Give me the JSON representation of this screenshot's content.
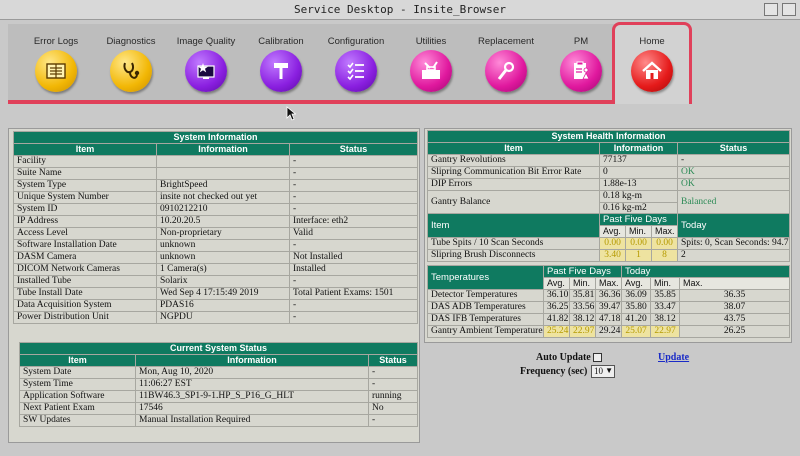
{
  "window": {
    "title": "Service Desktop - Insite_Browser"
  },
  "toolbar": [
    {
      "label": "Error Logs",
      "icon": "logbook-icon",
      "color": "#f2b705"
    },
    {
      "label": "Diagnostics",
      "icon": "stethoscope-icon",
      "color": "#f2b705"
    },
    {
      "label": "Image Quality",
      "icon": "monitor-star-icon",
      "color": "#8a1fe0"
    },
    {
      "label": "Calibration",
      "icon": "hammer-icon",
      "color": "#8a1fe0"
    },
    {
      "label": "Configuration",
      "icon": "checklist-icon",
      "color": "#8a1fe0"
    },
    {
      "label": "Utilities",
      "icon": "toolbox-icon",
      "color": "#e0189e"
    },
    {
      "label": "Replacement",
      "icon": "wrench-icon",
      "color": "#e0189e"
    },
    {
      "label": "PM",
      "icon": "clipboard-person-icon",
      "color": "#e0189e"
    },
    {
      "label": "Home",
      "icon": "home-icon",
      "color": "#e51a1a",
      "active": true
    }
  ],
  "system_info": {
    "title": "System Information",
    "headers": [
      "Item",
      "Information",
      "Status"
    ],
    "rows": [
      [
        "Facility",
        "",
        "-"
      ],
      [
        "Suite Name",
        "",
        "-"
      ],
      [
        "System Type",
        "BrightSpeed",
        "-"
      ],
      [
        "Unique System Number",
        "insite not checked out yet",
        "-"
      ],
      [
        "System ID",
        "0910212210",
        "-"
      ],
      [
        "IP Address",
        "10.20.20.5",
        "Interface: eth2"
      ],
      [
        "Access Level",
        "Non-proprietary",
        "Valid"
      ],
      [
        "Software Installation Date",
        "unknown",
        "-"
      ],
      [
        "DASM Camera",
        "unknown",
        "Not Installed"
      ],
      [
        "DICOM Network Cameras",
        "1 Camera(s)",
        "Installed"
      ],
      [
        "Installed Tube",
        "Solarix",
        "-"
      ],
      [
        "Tube Install Date",
        "Wed Sep 4 17:15:49 2019",
        "Total Patient Exams: 1501"
      ],
      [
        "Data Acquisition System",
        "PDAS16",
        "-"
      ],
      [
        "Power Distribution Unit",
        "NGPDU",
        "-"
      ]
    ]
  },
  "current_status": {
    "title": "Current System Status",
    "headers": [
      "Item",
      "Information",
      "Status"
    ],
    "rows": [
      [
        "System Date",
        "Mon, Aug 10, 2020",
        "-"
      ],
      [
        "System Time",
        "11:06:27 EST",
        "-"
      ],
      [
        "Application Software",
        "11BW46.3_SP1-9-1.HP_S_P16_G_HLT",
        "running"
      ],
      [
        "Next Patient Exam",
        "17546",
        "No"
      ],
      [
        "SW Updates",
        "Manual Installation Required",
        "-"
      ]
    ]
  },
  "health": {
    "title": "System Health Information",
    "headers": [
      "Item",
      "Information",
      "Status"
    ],
    "rows": [
      [
        "Gantry Revolutions",
        "77137",
        "-"
      ],
      [
        "Slipring Communication Bit Error Rate",
        "0",
        "OK"
      ],
      [
        "DIP Errors",
        "1.88e-13",
        "OK"
      ]
    ],
    "balance": {
      "label": "Gantry Balance",
      "values": [
        "0.18 kg-m",
        "0.16 kg-m2"
      ],
      "status": "Balanced"
    },
    "stats": {
      "item_header": "Item",
      "past_header": "Past Five Days",
      "today_header": "Today",
      "sub": [
        "Avg.",
        "Min.",
        "Max."
      ],
      "rows": [
        {
          "label": "Tube Spits / 10 Scan Seconds",
          "values": [
            "0.00",
            "0.00",
            "0.00"
          ],
          "today": "Spits: 0, Scan Seconds: 94.7"
        },
        {
          "label": "Slipring Brush Disconnects",
          "values": [
            "3.40",
            "1",
            "8"
          ],
          "today": "2"
        }
      ]
    },
    "temps": {
      "header": "Temperatures",
      "past_header": "Past Five Days",
      "today_header": "Today",
      "sub": [
        "Avg.",
        "Min.",
        "Max.",
        "Avg.",
        "Min.",
        "Max."
      ],
      "rows": [
        {
          "label": "Detector Temperatures",
          "values": [
            "36.10",
            "35.81",
            "36.36",
            "36.09",
            "35.85",
            "36.35"
          ]
        },
        {
          "label": "DAS ADB Temperatures",
          "values": [
            "36.25",
            "33.56",
            "39.47",
            "35.80",
            "33.47",
            "38.07"
          ]
        },
        {
          "label": "DAS IFB Temperatures",
          "values": [
            "41.82",
            "38.12",
            "47.18",
            "41.20",
            "38.12",
            "43.75"
          ]
        },
        {
          "label": "Gantry Ambient Temperatures",
          "values": [
            "25.24",
            "22.97",
            "29.24",
            "25.07",
            "22.97",
            "26.25"
          ]
        }
      ]
    }
  },
  "controls": {
    "auto_update_label": "Auto Update",
    "frequency_label": "Frequency (sec)",
    "frequency_value": "10",
    "update_link": "Update"
  }
}
